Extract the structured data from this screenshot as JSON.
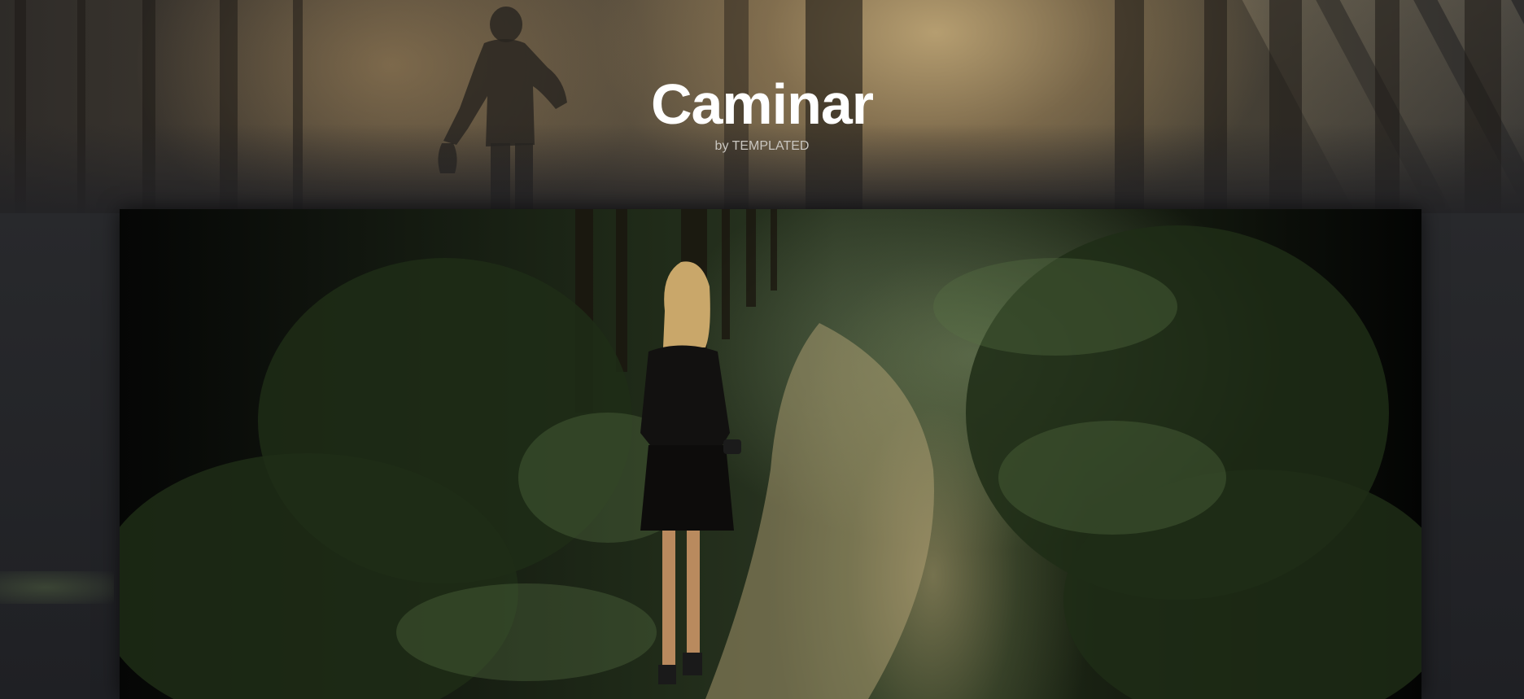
{
  "header": {
    "title": "Caminar",
    "byline_prefix": "by ",
    "byline_link": "TEMPLATED"
  },
  "hero": {
    "image": "forest-hiker-silhouette"
  },
  "feature": {
    "image": "woman-walking-forest-path"
  },
  "colors": {
    "page_background": "#1f2024",
    "title_text": "#ffffff",
    "byline_text": "#c9c6c0"
  }
}
